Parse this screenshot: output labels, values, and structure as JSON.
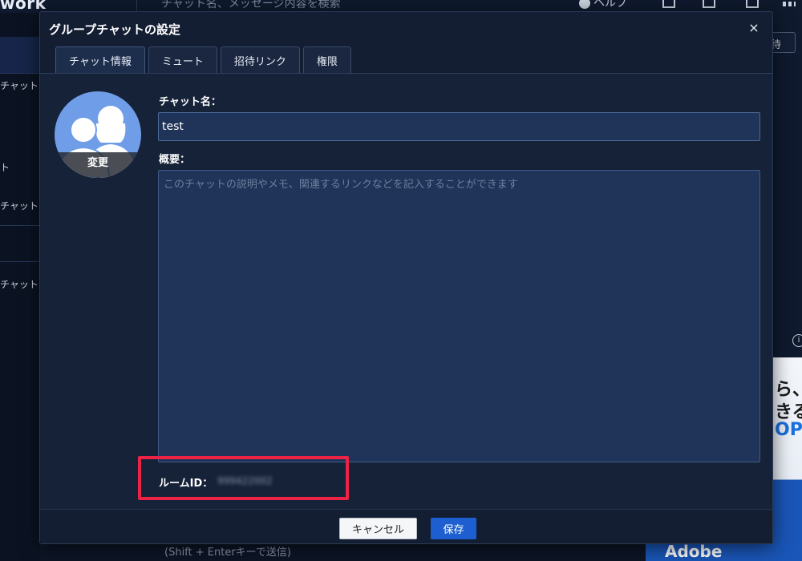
{
  "background": {
    "logo_text": "work",
    "search_placeholder": "チャット名、メッセージ内容を検索",
    "help_label": "ヘルプ",
    "sidebar_items": [
      "チャット",
      "ト",
      "チャット",
      "チャットを"
    ],
    "right_button": "待",
    "composer_hint": "(Shift + Enterキーで送信)",
    "ad_lines": [
      "ら、",
      "きる",
      "OP"
    ],
    "ad_brand": "Adobe"
  },
  "dialog": {
    "title": "グループチャットの設定",
    "close_glyph": "×",
    "tabs": [
      {
        "label": "チャット情報",
        "active": true
      },
      {
        "label": "ミュート",
        "active": false
      },
      {
        "label": "招待リンク",
        "active": false
      },
      {
        "label": "権限",
        "active": false
      }
    ],
    "avatar_change_label": "変更",
    "chat_name_label": "チャット名：",
    "chat_name_value": "test",
    "description_label": "概要：",
    "description_placeholder": "このチャットの説明やメモ、関連するリンクなどを記入することができます",
    "room_id_label": "ルームID：",
    "room_id_value": "999422002",
    "cancel_label": "キャンセル",
    "save_label": "保存"
  },
  "colors": {
    "dialog_bg": "#131e33",
    "input_bg": "#1f3458",
    "highlight": "#ee2244",
    "save_button": "#1d5fd0",
    "avatar": "#6f9de8"
  },
  "icons": {
    "close": "close-icon",
    "avatar": "group-avatar-icon",
    "help": "help-circle-icon",
    "info": "info-icon"
  }
}
